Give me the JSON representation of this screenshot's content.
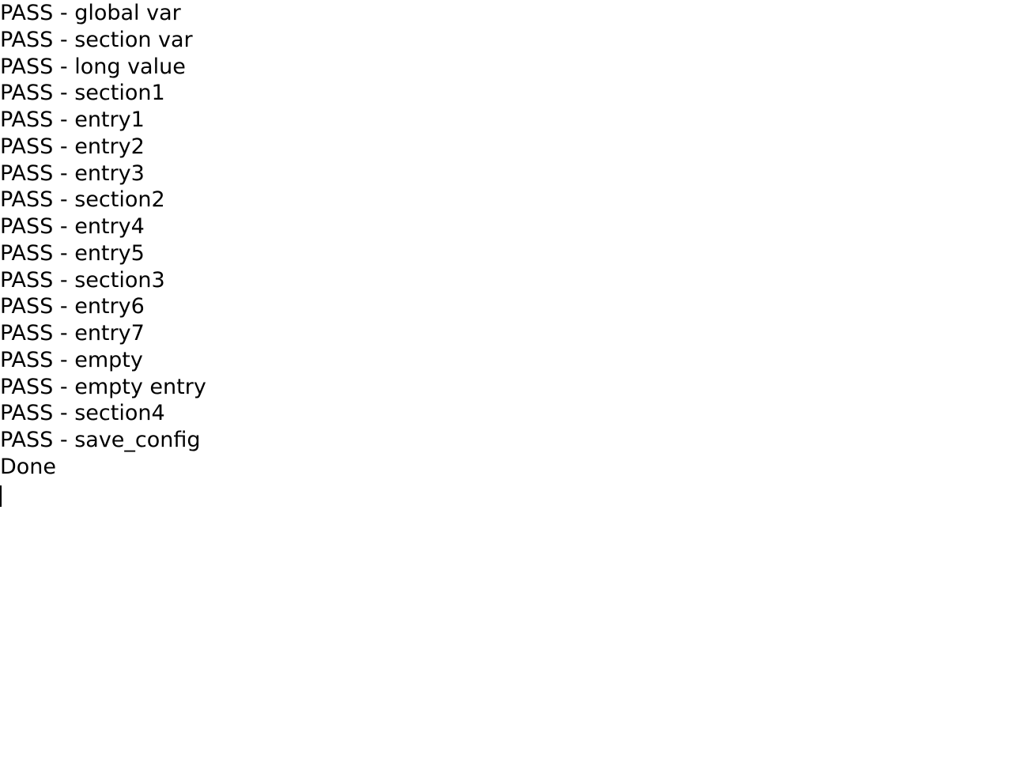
{
  "output": {
    "lines": [
      "PASS - global var",
      "PASS - section var",
      "PASS - long value",
      "PASS - section1",
      "PASS - entry1",
      "PASS - entry2",
      "PASS - entry3",
      "PASS - section2",
      "PASS - entry4",
      "PASS - entry5",
      "PASS - section3",
      "PASS - entry6",
      "PASS - entry7",
      "PASS - empty",
      "PASS - empty entry",
      "PASS - section4",
      "PASS - save_config",
      "Done"
    ]
  }
}
